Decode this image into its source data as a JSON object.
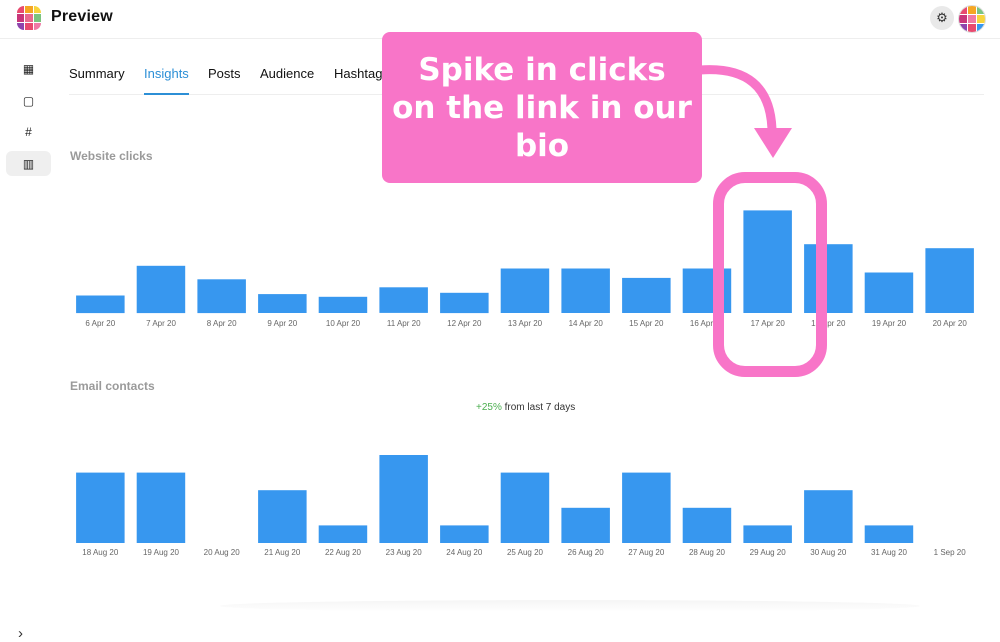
{
  "app": {
    "title": "Preview"
  },
  "header": {
    "settings_icon": "gear-icon",
    "avatar_icon": "avatar-icon"
  },
  "sidebar": {
    "items": [
      {
        "icon": "grid-icon",
        "glyph": "▦"
      },
      {
        "icon": "calendar-icon",
        "glyph": "▢"
      },
      {
        "icon": "hashtag-icon",
        "glyph": "#"
      },
      {
        "icon": "bar-chart-icon",
        "glyph": "▥"
      }
    ],
    "expand_glyph": "›"
  },
  "tabs": [
    {
      "label": "Summary"
    },
    {
      "label": "Insights"
    },
    {
      "label": "Posts"
    },
    {
      "label": "Audience"
    },
    {
      "label": "Hashtag"
    }
  ],
  "website_clicks": {
    "title": "Website clicks"
  },
  "email_contacts": {
    "title": "Email contacts",
    "change": "+25%",
    "change_suffix": "from last 7 days"
  },
  "callout": {
    "text": "Spike in clicks on the link in our bio"
  },
  "colors": {
    "bar": "#3797ef",
    "callout": "#f875c8",
    "accent": "#2c8fd6",
    "positive": "#4caf50"
  },
  "chart_data": [
    {
      "type": "bar",
      "categories": [
        "6 Apr 20",
        "7 Apr 20",
        "8 Apr 20",
        "9 Apr 20",
        "10 Apr 20",
        "11 Apr 20",
        "12 Apr 20",
        "13 Apr 20",
        "14 Apr 20",
        "15 Apr 20",
        "16 Apr 20",
        "17 Apr 20",
        "18 Apr 20",
        "19 Apr 20",
        "20 Apr 20"
      ],
      "values": [
        13,
        35,
        25,
        14,
        12,
        19,
        15,
        33,
        33,
        26,
        33,
        76,
        51,
        30,
        48
      ],
      "ylim": [
        0,
        80
      ],
      "title": "Website clicks"
    },
    {
      "type": "bar",
      "categories": [
        "18 Aug 20",
        "19 Aug 20",
        "20 Aug 20",
        "21 Aug 20",
        "22 Aug 20",
        "23 Aug 20",
        "24 Aug 20",
        "25 Aug 20",
        "26 Aug 20",
        "27 Aug 20",
        "28 Aug 20",
        "29 Aug 20",
        "30 Aug 20",
        "31 Aug 20",
        "1 Sep 20"
      ],
      "values": [
        4,
        4,
        0,
        3,
        1,
        5,
        1,
        4,
        2,
        4,
        2,
        1,
        3,
        1,
        0
      ],
      "ylim": [
        0,
        5
      ],
      "title": "Email contacts"
    }
  ]
}
